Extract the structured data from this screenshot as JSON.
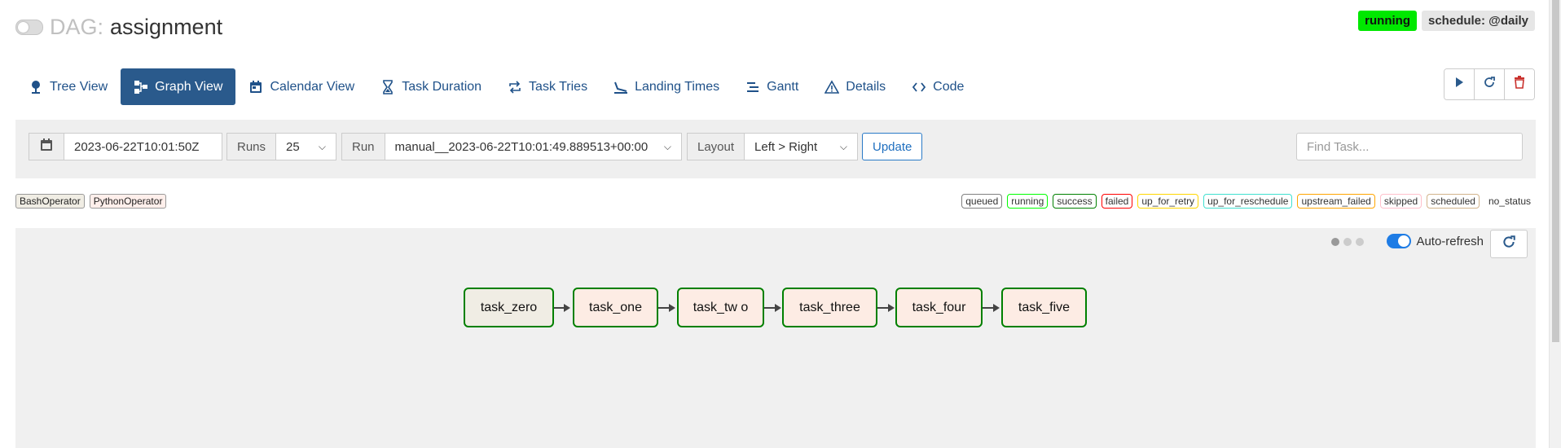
{
  "header": {
    "dag_prefix": "DAG:",
    "dag_name": "assignment",
    "status_badge": "running",
    "schedule_badge": "schedule: @daily",
    "status_color": "#00e800"
  },
  "nav": {
    "tabs": [
      {
        "label": "Tree View",
        "icon": "tree-icon"
      },
      {
        "label": "Graph View",
        "icon": "graph-icon",
        "active": true
      },
      {
        "label": "Calendar View",
        "icon": "calendar-icon"
      },
      {
        "label": "Task Duration",
        "icon": "hourglass-icon"
      },
      {
        "label": "Task Tries",
        "icon": "retry-icon"
      },
      {
        "label": "Landing Times",
        "icon": "landing-icon"
      },
      {
        "label": "Gantt",
        "icon": "gantt-icon"
      },
      {
        "label": "Details",
        "icon": "warning-icon"
      },
      {
        "label": "Code",
        "icon": "code-icon"
      }
    ],
    "actions": [
      "play-icon",
      "refresh-icon",
      "trash-icon"
    ]
  },
  "controls": {
    "base_date": "2023-06-22T10:01:50Z",
    "runs_label": "Runs",
    "runs_value": "25",
    "run_label": "Run",
    "run_value": "manual__2023-06-22T10:01:49.889513+00:00",
    "layout_label": "Layout",
    "layout_value": "Left > Right",
    "update_label": "Update",
    "find_task_placeholder": "Find Task..."
  },
  "legend": {
    "operators": [
      {
        "name": "BashOperator",
        "color": "#f0ede4"
      },
      {
        "name": "PythonOperator",
        "color": "#ffefeb"
      }
    ],
    "states": [
      {
        "name": "queued",
        "color": "#808080"
      },
      {
        "name": "running",
        "color": "#00ff00"
      },
      {
        "name": "success",
        "color": "#008000"
      },
      {
        "name": "failed",
        "color": "#ff0000"
      },
      {
        "name": "up_for_retry",
        "color": "#ffd700"
      },
      {
        "name": "up_for_reschedule",
        "color": "#40e0d0"
      },
      {
        "name": "upstream_failed",
        "color": "#ffa500"
      },
      {
        "name": "skipped",
        "color": "#ffc0cb"
      },
      {
        "name": "scheduled",
        "color": "#d2b48c"
      },
      {
        "name": "no_status",
        "color": ""
      }
    ]
  },
  "graph": {
    "autorefresh_label": "Auto-refresh",
    "tasks": [
      "task_zero",
      "task_one",
      "task_tw o",
      "task_three",
      "task_four",
      "task_five"
    ]
  }
}
